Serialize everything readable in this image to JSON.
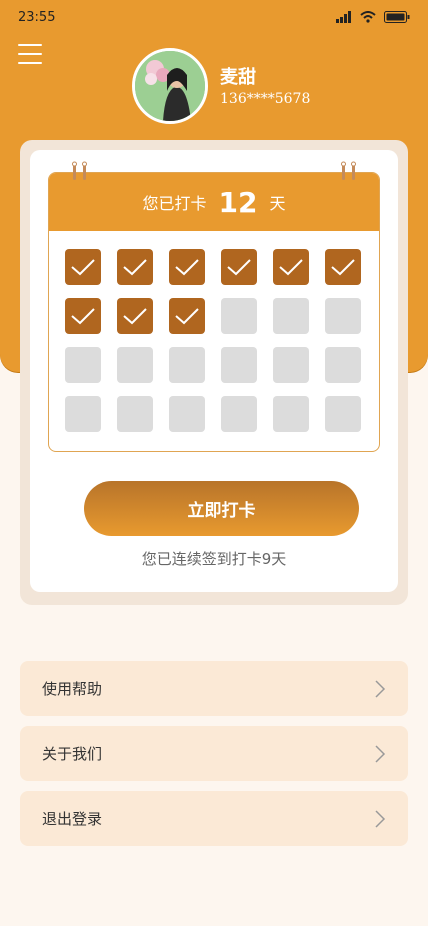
{
  "status_bar": {
    "time": "23:55"
  },
  "profile": {
    "name": "麦甜",
    "phone": "136****5678"
  },
  "calendar": {
    "prefix": "您已打卡",
    "count": "12",
    "suffix": "天",
    "total_cells": 24,
    "checked_cells": 9
  },
  "checkin": {
    "button_label": "立即打卡",
    "streak_text": "您已连续签到打卡9天"
  },
  "menu": {
    "items": [
      {
        "label": "使用帮助"
      },
      {
        "label": "关于我们"
      },
      {
        "label": "退出登录"
      }
    ]
  },
  "colors": {
    "accent": "#e89a2f",
    "checked": "#b0661f",
    "empty": "#dcdcdc",
    "page_bg": "#fdf6ef",
    "menu_bg": "#fbe9d6"
  },
  "icons": [
    "menu-icon",
    "signal-icon",
    "wifi-icon",
    "battery-icon",
    "check-icon",
    "chevron-right-icon"
  ]
}
